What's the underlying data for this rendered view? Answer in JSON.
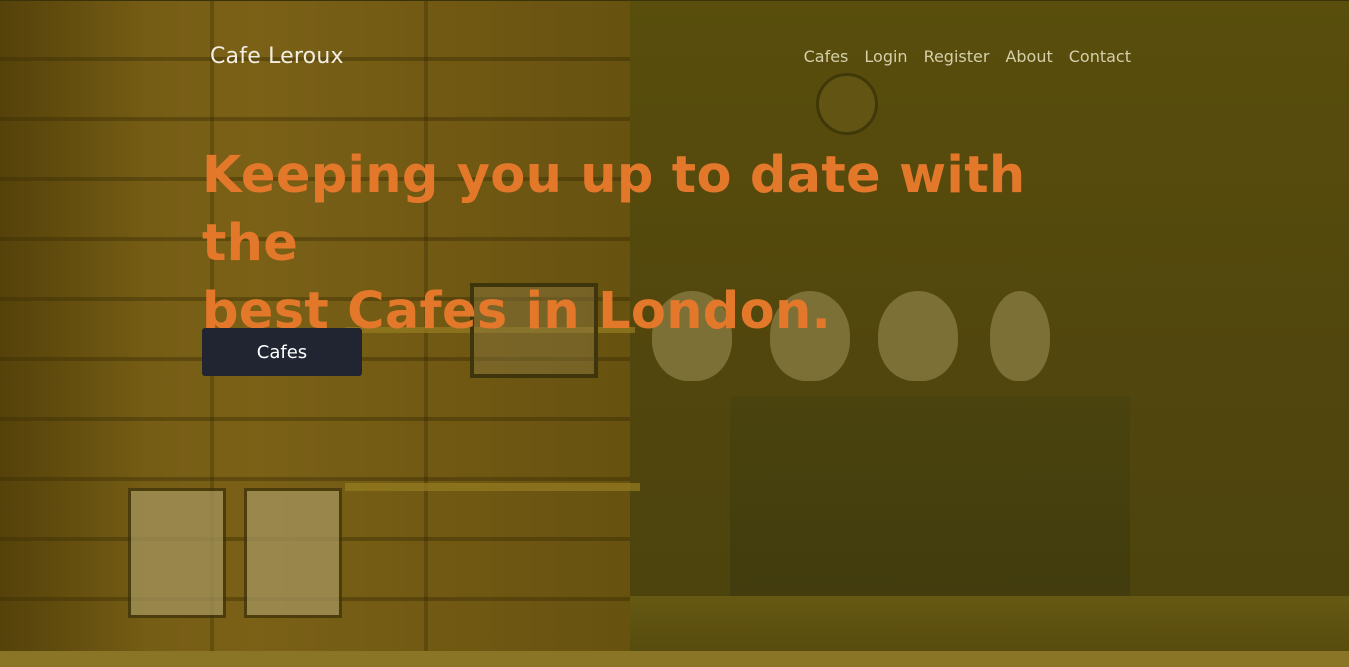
{
  "brand": {
    "name": "Cafe Leroux"
  },
  "nav": {
    "items": [
      {
        "label": "Cafes"
      },
      {
        "label": "Login"
      },
      {
        "label": "Register"
      },
      {
        "label": "About"
      },
      {
        "label": "Contact"
      }
    ]
  },
  "hero": {
    "headline_line1": "Keeping you up to date with the",
    "headline_line2": "best Cafes in London.",
    "cta_label": "Cafes"
  },
  "colors": {
    "headline": "#e3782b",
    "button_bg": "#202531",
    "overlay_tint": "#5a4d0e",
    "footer_strip": "#8a7526"
  }
}
